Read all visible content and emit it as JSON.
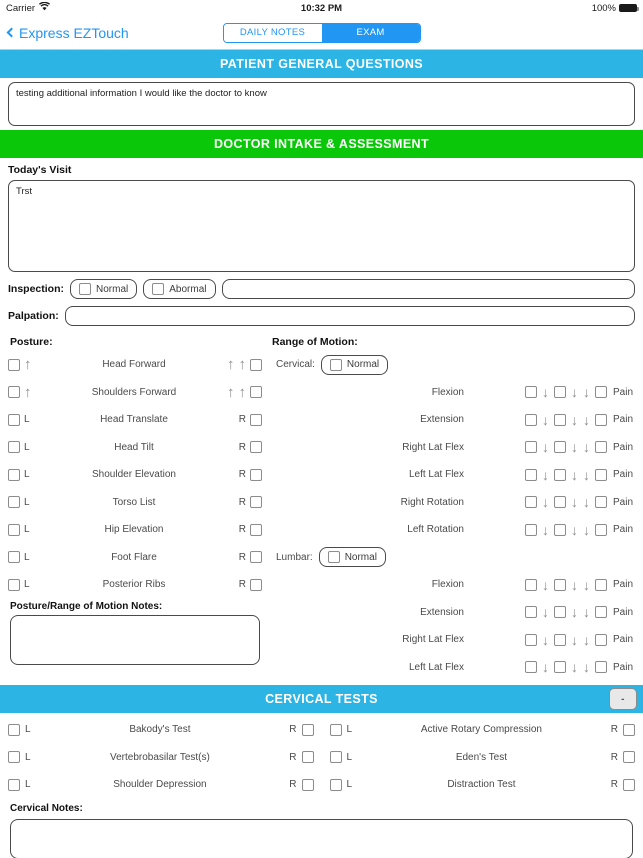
{
  "statusbar": {
    "carrier": "Carrier",
    "wifi_icon": "wifi-icon",
    "time": "10:32 PM",
    "battery_pct": "100%"
  },
  "navbar": {
    "back_label": "Express EZTouch",
    "back_icon": "chevron-left-icon",
    "segments": [
      {
        "label": "DAILY NOTES",
        "active": false
      },
      {
        "label": "EXAM",
        "active": true
      }
    ]
  },
  "sections": {
    "patient_general": {
      "title": "PATIENT GENERAL QUESTIONS",
      "color": "#2cb4e4",
      "notes_value": "testing additional information I would like the doctor to know"
    },
    "doctor_intake": {
      "title": "DOCTOR INTAKE & ASSESSMENT",
      "color": "#0bc709"
    },
    "cervical_tests": {
      "title": "CERVICAL TESTS",
      "color": "#2cb4e4",
      "collapse_label": "-"
    }
  },
  "todays_visit": {
    "label": "Today's Visit",
    "value": "Trst"
  },
  "inspection": {
    "label": "Inspection:",
    "options": [
      "Normal",
      "Abormal"
    ],
    "field_value": ""
  },
  "palpation": {
    "label": "Palpation:",
    "field_value": ""
  },
  "posture": {
    "heading": "Posture:",
    "rows": [
      {
        "name": "Head Forward",
        "left_icon": "arrow-up",
        "right_icon": "arrow-up-double"
      },
      {
        "name": "Shoulders Forward",
        "left_icon": "arrow-up",
        "right_icon": "arrow-up-double"
      },
      {
        "name": "Head Translate",
        "left_icon": "L",
        "right_icon": "R"
      },
      {
        "name": "Head Tilt",
        "left_icon": "L",
        "right_icon": "R"
      },
      {
        "name": "Shoulder Elevation",
        "left_icon": "L",
        "right_icon": "R"
      },
      {
        "name": "Torso List",
        "left_icon": "L",
        "right_icon": "R"
      },
      {
        "name": "Hip Elevation",
        "left_icon": "L",
        "right_icon": "R"
      },
      {
        "name": "Foot Flare",
        "left_icon": "L",
        "right_icon": "R"
      },
      {
        "name": "Posterior Ribs",
        "left_icon": "L",
        "right_icon": "R"
      }
    ],
    "notes_label": "Posture/Range of Motion Notes:",
    "notes_value": ""
  },
  "range_of_motion": {
    "heading": "Range of Motion:",
    "cervical": {
      "label": "Cervical:",
      "normal_label": "Normal"
    },
    "lumbar": {
      "label": "Lumbar:",
      "normal_label": "Normal"
    },
    "pain_label": "Pain",
    "cervical_movements": [
      "Flexion",
      "Extension",
      "Right Lat Flex",
      "Left Lat Flex",
      "Right Rotation",
      "Left Rotation"
    ],
    "lumbar_movements": [
      "Flexion",
      "Extension",
      "Right Lat Flex",
      "Left Lat Flex"
    ]
  },
  "cervical_tests": {
    "rows": [
      {
        "left_side": "L",
        "left_name": "Bakody's Test",
        "left_right_side": "R",
        "right_side": "L",
        "right_name": "Active Rotary Compression",
        "right_right_side": "R"
      },
      {
        "left_side": "L",
        "left_name": "Vertebrobasilar Test(s)",
        "left_right_side": "R",
        "right_side": "L",
        "right_name": "Eden's Test",
        "right_right_side": "R"
      },
      {
        "left_side": "L",
        "left_name": "Shoulder Depression",
        "left_right_side": "R",
        "right_side": "L",
        "right_name": "Distraction Test",
        "right_right_side": "R"
      }
    ],
    "notes_label": "Cervical Notes:",
    "notes_value": ""
  }
}
